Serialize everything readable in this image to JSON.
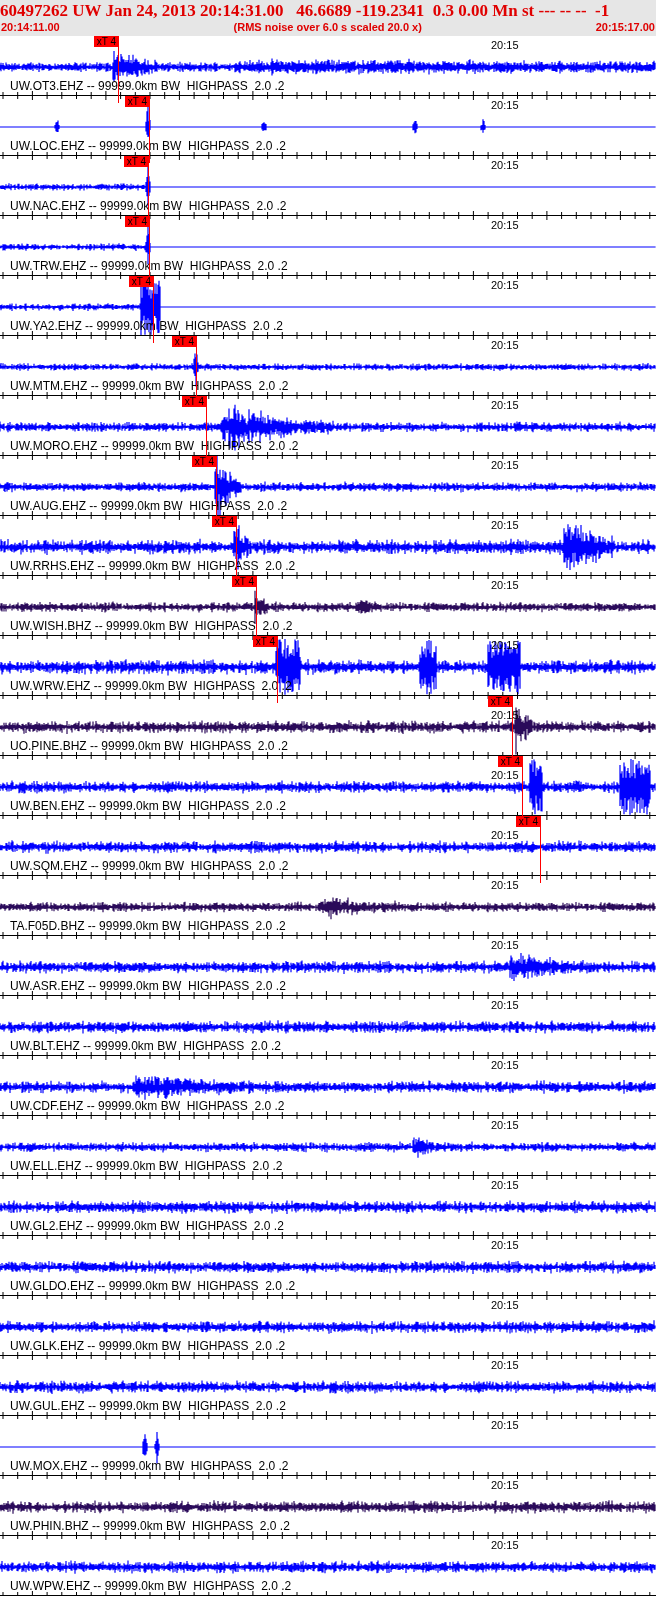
{
  "header": {
    "title": "60497262 UW Jan 24, 2013 20:14:31.00   46.6689 -119.2341  0.3 0.00 Mn st --- -- --  -1",
    "start_time": "20:14:11.00",
    "note": "(RMS noise over 6.0 s scaled 20.0 x)",
    "end_time": "20:15:17.00"
  },
  "traces": [
    {
      "label": "UW.OT3.EHZ -- 99999.0km BW  HIGHPASS  2.0 .2",
      "color": "#0000ff",
      "time_label": "20:15",
      "pick": "xT 4"
    },
    {
      "label": "UW.LOC.EHZ -- 99999.0km BW  HIGHPASS  2.0 .2",
      "color": "#0000ff",
      "time_label": "20:15",
      "pick": "xT 4"
    },
    {
      "label": "UW.NAC.EHZ -- 99999.0km BW  HIGHPASS  2.0 .2",
      "color": "#0000ff",
      "time_label": "20:15",
      "pick": "xT 4"
    },
    {
      "label": "UW.TRW.EHZ -- 99999.0km BW  HIGHPASS  2.0 .2",
      "color": "#0000ff",
      "time_label": "20:15",
      "pick": "xT 4"
    },
    {
      "label": "UW.YA2.EHZ -- 99999.0km BW  HIGHPASS  2.0 .2",
      "color": "#0000ff",
      "time_label": "20:15",
      "pick": "xT 4"
    },
    {
      "label": "UW.MTM.EHZ -- 99999.0km BW  HIGHPASS  2.0 .2",
      "color": "#0000ff",
      "time_label": "20:15",
      "pick": "xT 4"
    },
    {
      "label": "UW.MORO.EHZ -- 99999.0km BW  HIGHPASS  2.0 .2",
      "color": "#0000ff",
      "time_label": "20:15",
      "pick": "xT 4"
    },
    {
      "label": "UW.AUG.EHZ -- 99999.0km BW  HIGHPASS  2.0 .2",
      "color": "#0000ff",
      "time_label": "20:15",
      "pick": "xT 4"
    },
    {
      "label": "UW.RRHS.EHZ -- 99999.0km BW  HIGHPASS  2.0 .2",
      "color": "#0000ff",
      "time_label": "20:15",
      "pick": "xT 4"
    },
    {
      "label": "UW.WISH.BHZ -- 99999.0km BW  HIGHPASS  2.0 .2",
      "color": "#2a0a5a",
      "time_label": "20:15",
      "pick": "xT 4"
    },
    {
      "label": "UW.WRW.EHZ -- 99999.0km BW  HIGHPASS  2.0 .2",
      "color": "#0000ff",
      "time_label": "20:15",
      "pick": "xT 4"
    },
    {
      "label": "UO.PINE.BHZ -- 99999.0km BW  HIGHPASS  2.0 .2",
      "color": "#2a0a5a",
      "time_label": "20:15",
      "pick": "xT 4"
    },
    {
      "label": "UW.BEN.EHZ -- 99999.0km BW  HIGHPASS  2.0 .2",
      "color": "#0000ff",
      "time_label": "20:15",
      "pick": "xT 4"
    },
    {
      "label": "UW.SQM.EHZ -- 99999.0km BW  HIGHPASS  2.0 .2",
      "color": "#0000ff",
      "time_label": "20:15",
      "pick": "xT 4"
    },
    {
      "label": "TA.F05D.BHZ -- 99999.0km BW  HIGHPASS  2.0 .2",
      "color": "#2a0a5a",
      "time_label": "20:15"
    },
    {
      "label": "UW.ASR.EHZ -- 99999.0km BW  HIGHPASS  2.0 .2",
      "color": "#0000ff",
      "time_label": "20:15"
    },
    {
      "label": "UW.BLT.EHZ -- 99999.0km BW  HIGHPASS  2.0 .2",
      "color": "#0000ff",
      "time_label": "20:15"
    },
    {
      "label": "UW.CDF.EHZ -- 99999.0km BW  HIGHPASS  2.0 .2",
      "color": "#0000ff",
      "time_label": "20:15"
    },
    {
      "label": "UW.ELL.EHZ -- 99999.0km BW  HIGHPASS  2.0 .2",
      "color": "#0000ff",
      "time_label": "20:15"
    },
    {
      "label": "UW.GL2.EHZ -- 99999.0km BW  HIGHPASS  2.0 .2",
      "color": "#0000ff",
      "time_label": "20:15"
    },
    {
      "label": "UW.GLDO.EHZ -- 99999.0km BW  HIGHPASS  2.0 .2",
      "color": "#0000ff",
      "time_label": "20:15"
    },
    {
      "label": "UW.GLK.EHZ -- 99999.0km BW  HIGHPASS  2.0 .2",
      "color": "#0000ff",
      "time_label": "20:15"
    },
    {
      "label": "UW.GUL.EHZ -- 99999.0km BW  HIGHPASS  2.0 .2",
      "color": "#0000ff",
      "time_label": "20:15"
    },
    {
      "label": "UW.MOX.EHZ -- 99999.0km BW  HIGHPASS  2.0 .2",
      "color": "#0000ff",
      "time_label": "20:15"
    },
    {
      "label": "UW.PHIN.BHZ -- 99999.0km BW  HIGHPASS  2.0 .2",
      "color": "#2a0a5a",
      "time_label": "20:15"
    },
    {
      "label": "UW.WPW.EHZ -- 99999.0km BW  HIGHPASS  2.0 .2",
      "color": "#0000ff",
      "time_label": "20:15"
    }
  ]
}
